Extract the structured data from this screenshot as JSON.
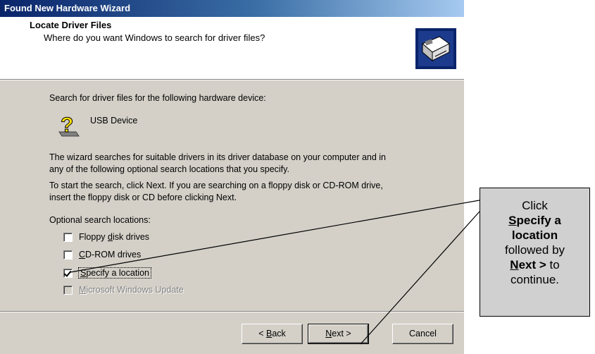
{
  "window": {
    "title": "Found New Hardware Wizard"
  },
  "header": {
    "title": "Locate Driver Files",
    "subtitle": "Where do you want Windows to search for driver files?",
    "icon": "hardware-card-icon"
  },
  "body": {
    "search_prompt": "Search for driver files for the following hardware device:",
    "device_name": "USB Device",
    "device_icon": "unknown-device-question-icon",
    "paragraph1_line1": "The wizard searches for suitable drivers in its driver database on your computer and in",
    "paragraph1_line2": "any of the following optional search locations that you specify.",
    "paragraph2_line1": "To start the search, click Next. If you are searching on a floppy disk or CD-ROM drive,",
    "paragraph2_line2": "insert the floppy disk or CD before clicking Next.",
    "optional_label": "Optional search locations:"
  },
  "options": [
    {
      "pre": "Floppy ",
      "key": "d",
      "post": "isk drives",
      "checked": false,
      "enabled": true
    },
    {
      "pre": "",
      "key": "C",
      "post": "D-ROM drives",
      "checked": false,
      "enabled": true
    },
    {
      "pre": "",
      "key": "S",
      "post": "pecify a location",
      "checked": true,
      "enabled": true
    },
    {
      "pre": "",
      "key": "M",
      "post": "icrosoft Windows Update",
      "checked": false,
      "enabled": false
    }
  ],
  "buttons": {
    "back_pre": "< ",
    "back_key": "B",
    "back_post": "ack",
    "next_key": "N",
    "next_post": "ext >",
    "cancel": "Cancel"
  },
  "callout": {
    "line1": "Click",
    "bold1_key": "S",
    "bold1_rest": "pecify a",
    "bold2": "location",
    "line3": "followed by",
    "bold3_key": "N",
    "bold3_rest": "ext >",
    "line4_tail": " to",
    "line5": "continue."
  }
}
